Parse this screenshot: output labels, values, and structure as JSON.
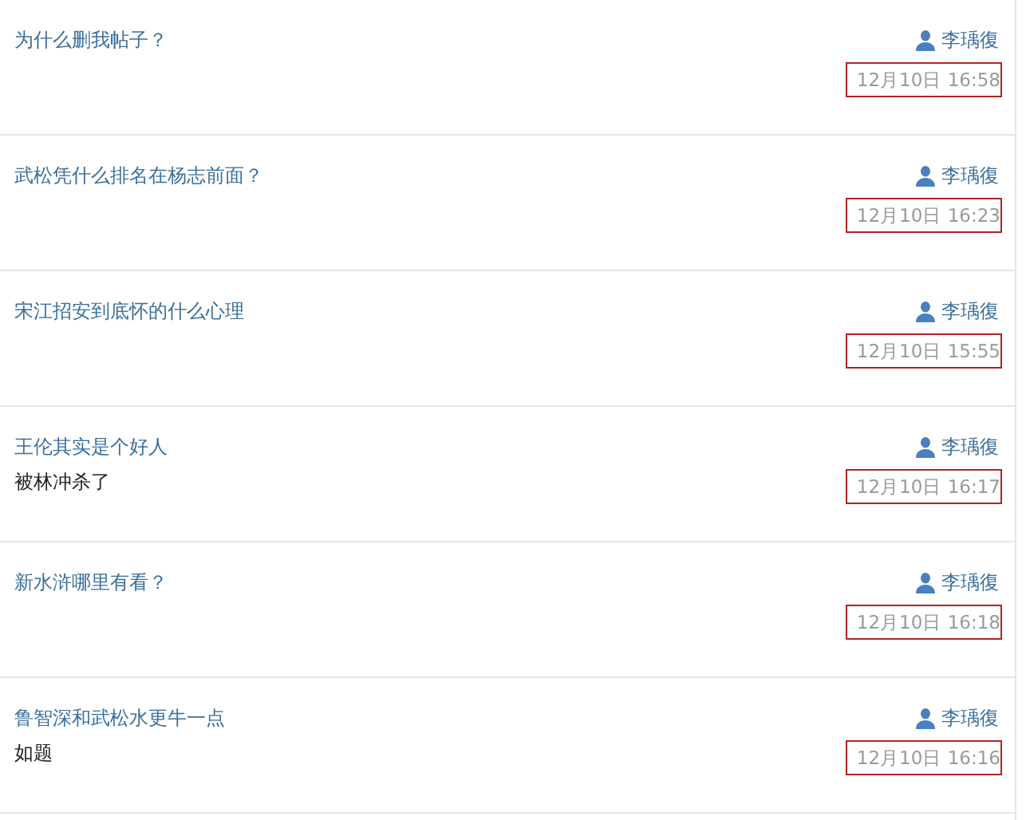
{
  "posts": [
    {
      "title": "为什么删我帖子？",
      "author": "李瑀復",
      "time": "12月10日 16:58",
      "highlighted": true
    },
    {
      "title": "武松凭什么排名在杨志前面？",
      "author": "李瑀復",
      "time": "12月10日 16:23",
      "highlighted": true
    },
    {
      "title": "宋江招安到底怀的什么心理",
      "author": "李瑀復",
      "time": "12月10日 15:55",
      "highlighted": true
    },
    {
      "title": "王伦其实是个好人",
      "body": "被林冲杀了",
      "author": "李瑀復",
      "time": "12月10日 16:17",
      "highlighted": true
    },
    {
      "title": "新水浒哪里有看？",
      "author": "李瑀復",
      "time": "12月10日 16:18",
      "highlighted": true
    },
    {
      "title": "鲁智深和武松水更牛一点",
      "body": "如题",
      "author": "李瑀復",
      "time": "12月10日 16:16",
      "highlighted": true
    }
  ]
}
